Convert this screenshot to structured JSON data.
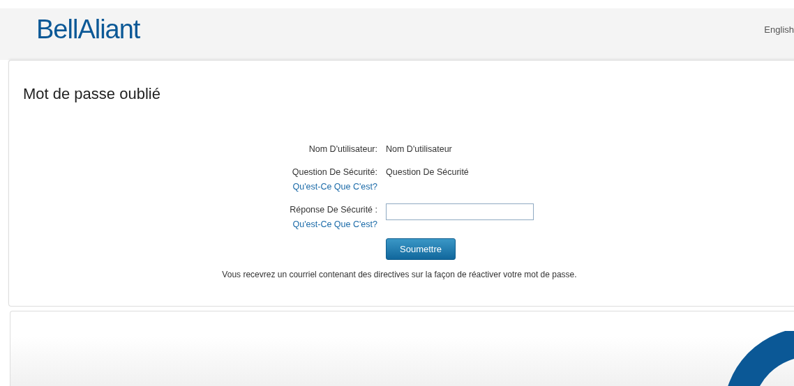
{
  "header": {
    "logo": "**Bell**Aliant",
    "language_link": "English"
  },
  "page_title": "Mot de passe oublié",
  "form": {
    "rows": [
      {
        "kind": "text",
        "label": "Nom D'utilisateur:",
        "value": "Nom D'utilisateur"
      },
      {
        "kind": "text",
        "label": "Question De Sécurité:",
        "help_link": "Qu'est-Ce Que C'est?",
        "value": "Question De Sécurité"
      },
      {
        "kind": "input",
        "label": "Réponse De Sécurité :",
        "help_link": "Qu'est-Ce Que C'est?"
      }
    ],
    "submit": "Soumettre",
    "note": "Vous recevrez un courriel contenant des directives sur la façon de réactiver votre mot de passe."
  }
}
